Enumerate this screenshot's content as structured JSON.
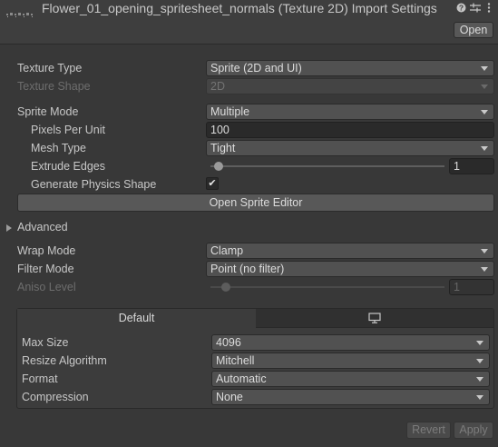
{
  "header": {
    "title": "Flower_01_opening_spritesheet_normals (Texture 2D) Import Settings",
    "open_label": "Open",
    "help_icon": "help-icon",
    "settings_icon": "preset-sliders-icon",
    "menu_icon": "kebab-menu-icon"
  },
  "texture_type": {
    "label": "Texture Type",
    "value": "Sprite (2D and UI)"
  },
  "texture_shape": {
    "label": "Texture Shape",
    "value": "2D"
  },
  "sprite_mode": {
    "label": "Sprite Mode",
    "value": "Multiple"
  },
  "pixels_per_unit": {
    "label": "Pixels Per Unit",
    "value": "100"
  },
  "mesh_type": {
    "label": "Mesh Type",
    "value": "Tight"
  },
  "extrude_edges": {
    "label": "Extrude Edges",
    "value": "1"
  },
  "generate_physics_shape": {
    "label": "Generate Physics Shape",
    "checked": true
  },
  "open_sprite_editor": "Open Sprite Editor",
  "advanced_label": "Advanced",
  "wrap_mode": {
    "label": "Wrap Mode",
    "value": "Clamp"
  },
  "filter_mode": {
    "label": "Filter Mode",
    "value": "Point (no filter)"
  },
  "aniso_level": {
    "label": "Aniso Level",
    "value": "1"
  },
  "platform": {
    "tab_default": "Default",
    "tab_standalone_icon": "monitor-icon",
    "max_size": {
      "label": "Max Size",
      "value": "4096"
    },
    "resize_algorithm": {
      "label": "Resize Algorithm",
      "value": "Mitchell"
    },
    "format": {
      "label": "Format",
      "value": "Automatic"
    },
    "compression": {
      "label": "Compression",
      "value": "None"
    }
  },
  "footer": {
    "revert_label": "Revert",
    "apply_label": "Apply"
  }
}
